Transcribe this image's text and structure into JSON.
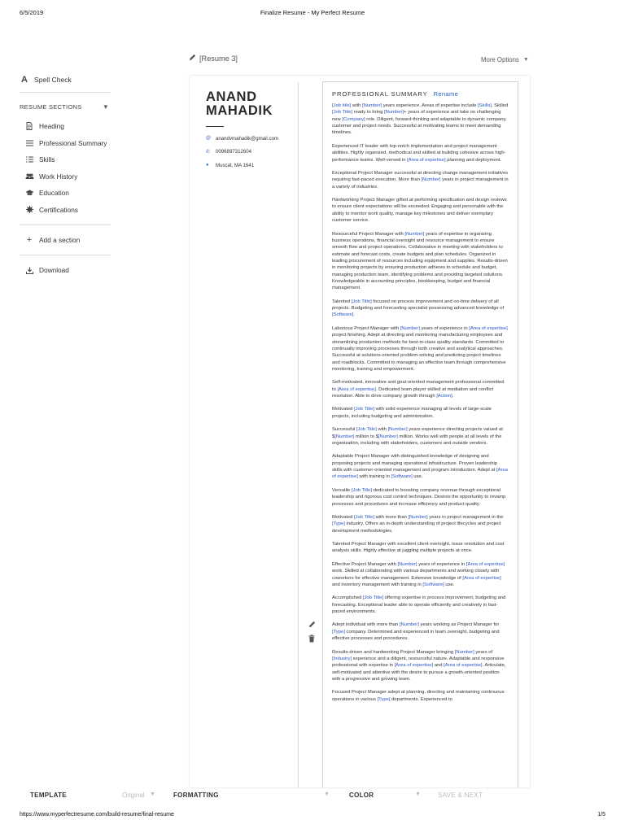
{
  "print_header": {
    "date": "6/5/2019",
    "title": "Finalize Resume - My Perfect Resume"
  },
  "print_footer": {
    "url": "https://www.myperfectresume.com/build-resume/final-resume",
    "pages": "1/5"
  },
  "sidebar": {
    "spell_check": "Spell Check",
    "sections_header": "RESUME SECTIONS",
    "items": [
      {
        "label": "Heading",
        "icon": "document-icon"
      },
      {
        "label": "Professional Summary",
        "icon": "list-icon"
      },
      {
        "label": "Skills",
        "icon": "bullet-list-icon"
      },
      {
        "label": "Work History",
        "icon": "people-icon"
      },
      {
        "label": "Education",
        "icon": "graduation-cap-icon"
      },
      {
        "label": "Certifications",
        "icon": "certificate-icon"
      }
    ],
    "add_section": "Add a section",
    "download": "Download"
  },
  "toolbar": {
    "resume_name": "[Resume 3]",
    "more_options": "More Options"
  },
  "resume": {
    "name_line1": "ANAND",
    "name_line2": "MAHADIK",
    "email": "anandvmahadik@gmail.com",
    "phone": "0096897312604",
    "location": "Muscat, MA 1641",
    "summary_heading": "PROFESSIONAL SUMMARY",
    "rename_label": "Rename",
    "paragraphs": [
      [
        {
          "t": "[Job title]",
          "p": true
        },
        {
          "t": " with "
        },
        {
          "t": "[Number]",
          "p": true
        },
        {
          "t": " years experience. Areas of expertise include "
        },
        {
          "t": "[Skills]",
          "p": true
        },
        {
          "t": ". Skilled "
        },
        {
          "t": "[Job Title]",
          "p": true
        },
        {
          "t": " ready to bring "
        },
        {
          "t": "[Number]",
          "p": true
        },
        {
          "t": "+ years of experience and take on challenging new "
        },
        {
          "t": "[Company]",
          "p": true
        },
        {
          "t": " role. Diligent, forward-thinking and adaptable to dynamic company, customer and project needs. Successful at motivating teams to meet demanding timelines."
        }
      ],
      [
        {
          "t": "Experienced IT leader with top-notch implementation and project management abilities. Highly organized, methodical and skilled at building cohesive across high-performance teams. Well-versed in "
        },
        {
          "t": "[Area of expertise]",
          "p": true
        },
        {
          "t": " planning and deployment."
        }
      ],
      [
        {
          "t": " Exceptional Project Manager successful at directing change management initiatives requiring fast-paced execution. More than "
        },
        {
          "t": "[Number]",
          "p": true
        },
        {
          "t": " years in project management in a variety of industries."
        }
      ],
      [
        {
          "t": "Hardworking Project Manager gifted at performing specification and design reviews to ensure client expectations will be exceeded. Engaging and personable with the ability to monitor work quality, manage key milestones and deliver exemplary customer service."
        }
      ],
      [
        {
          "t": "Resourceful Project Manager with "
        },
        {
          "t": "[Number]",
          "p": true
        },
        {
          "t": " years of expertise in organizing business operations, financial oversight and resource management to ensure smooth flow and project operations. Collaborative in meeting with stakeholders to estimate and forecast costs, create budgets and plan schedules. Organized in leading procurement of resources including equipment and supplies. Results-driven in monitoring projects by ensuring production adheres to schedule and budget, managing production team, identifying problems and providing targeted solutions. Knowledgeable in accounting principles, bookkeeping, budget and financial management."
        }
      ],
      [
        {
          "t": " Talented "
        },
        {
          "t": "[Job Title]",
          "p": true
        },
        {
          "t": " focused on process improvement and on-time delivery of all projects. Budgeting and forecasting specialist possessing advanced knowledge of "
        },
        {
          "t": "[Software]",
          "p": true
        },
        {
          "t": "."
        }
      ],
      [
        {
          "t": "Laborious Project Manager with "
        },
        {
          "t": "[Number]",
          "p": true
        },
        {
          "t": " years of experience in "
        },
        {
          "t": "[Area of expertise]",
          "p": true
        },
        {
          "t": " project finishing. Adept at directing and monitoring manufacturing employees and streamlining production methods for best-in-class quality standards. Committed to continually improving processes through both creative and analytical approaches. Successful at solutions-oriented problem-solving and predicting project timelines and roadblocks. Committed to managing an effective team through comprehensive monitoring, training and empowerment."
        }
      ],
      [
        {
          "t": "Self-motivated, innovative and goal-oriented management professional committed to "
        },
        {
          "t": "[Area of expertise]",
          "p": true
        },
        {
          "t": ". Dedicated team player skilled at mediation and conflict resolution. Able to drive company growth through "
        },
        {
          "t": "[Action]",
          "p": true
        },
        {
          "t": "."
        }
      ],
      [
        {
          "t": " Motivated "
        },
        {
          "t": "[Job Title]",
          "p": true
        },
        {
          "t": " with solid experience managing all levels of large-scale projects, including budgeting and administration."
        }
      ],
      [
        {
          "t": "Successful "
        },
        {
          "t": "[Job Title]",
          "p": true
        },
        {
          "t": " with "
        },
        {
          "t": "[Number]",
          "p": true
        },
        {
          "t": " years experience directing projects valued at $"
        },
        {
          "t": "[Number]",
          "p": true
        },
        {
          "t": " million to $"
        },
        {
          "t": "[Number]",
          "p": true
        },
        {
          "t": " million. Works well with people at all levels of the organization, including with stakeholders, customers and outside vendors."
        }
      ],
      [
        {
          "t": "Adaptable Project Manager with distinguished knowledge of designing and proposing projects and managing operational infrastructure. Proven leadership skills with customer-oriented management and program introduction. Adept at "
        },
        {
          "t": "[Area of expertise]",
          "p": true
        },
        {
          "t": " with training in "
        },
        {
          "t": "[Software]",
          "p": true
        },
        {
          "t": " use."
        }
      ],
      [
        {
          "t": "Versatile "
        },
        {
          "t": "[Job Title]",
          "p": true
        },
        {
          "t": " dedicated to boosting company revenue through exceptional leadership and rigorous cost control techniques. Desires the opportunity to revamp processes and procedures and increase efficiency and product quality."
        }
      ],
      [
        {
          "t": "Motivated "
        },
        {
          "t": "[Job Title]",
          "p": true
        },
        {
          "t": " with more than "
        },
        {
          "t": "[Number]",
          "p": true
        },
        {
          "t": " years in project management in the "
        },
        {
          "t": "[Type]",
          "p": true
        },
        {
          "t": " industry. Offers an in-depth understanding of project lifecycles and project development methodologies."
        }
      ],
      [
        {
          "t": "Talented Project Manager with excellent client oversight, issue resolution and cost analysis skills. Highly effective at juggling multiple projects at once."
        }
      ],
      [
        {
          "t": "Effective Project Manager with "
        },
        {
          "t": "[Number]",
          "p": true
        },
        {
          "t": " years of experience in "
        },
        {
          "t": "[Area of expertise]",
          "p": true
        },
        {
          "t": " work. Skilled at collaborating with various departments and working closely with coworkers for effective management. Extensive knowledge of "
        },
        {
          "t": "[Area of expertise]",
          "p": true
        },
        {
          "t": " and inventory management with training in "
        },
        {
          "t": "[Software]",
          "p": true
        },
        {
          "t": " use."
        }
      ],
      [
        {
          "t": "Accomplished "
        },
        {
          "t": "[Job Title]",
          "p": true
        },
        {
          "t": " offering expertise in process improvement, budgeting and forecasting. Exceptional leader able to operate efficiently and creatively in fast-paced environments."
        }
      ],
      [
        {
          "t": "Adept individual with more than "
        },
        {
          "t": "[Number]",
          "p": true
        },
        {
          "t": " years working as Project Manager for "
        },
        {
          "t": "[Type]",
          "p": true
        },
        {
          "t": " company. Determined and experienced in team oversight, budgeting and effective processes and procedures."
        }
      ],
      [
        {
          "t": " Results-driven and hardworking Project Manager bringing "
        },
        {
          "t": "[Number]",
          "p": true
        },
        {
          "t": " years of "
        },
        {
          "t": "[Industry]",
          "p": true
        },
        {
          "t": " experience and a diligent, resourceful nature. Adaptable and responsive professional with expertise in "
        },
        {
          "t": "[Area of expertise]",
          "p": true
        },
        {
          "t": " and "
        },
        {
          "t": "[Area of expertise]",
          "p": true
        },
        {
          "t": ". Articulate, self-motivated and attentive with the desire to pursue a growth-oriented position with a progressive and growing team."
        }
      ],
      [
        {
          "t": "Focused Project Manager adept at planning, directing and maintaining continuous operations in various "
        },
        {
          "t": "[Type]",
          "p": true
        },
        {
          "t": " departments. Experienced to"
        }
      ]
    ]
  },
  "bottombar": {
    "template": "TEMPLATE",
    "template_value": "Original",
    "formatting": "FORMATTING",
    "color": "COLOR",
    "save_next": "SAVE & NEXT"
  },
  "colors": {
    "placeholder_blue": "#2a55c5",
    "rename_blue": "#2a62c9",
    "contact_icon_blue": "#3a6fbf"
  }
}
